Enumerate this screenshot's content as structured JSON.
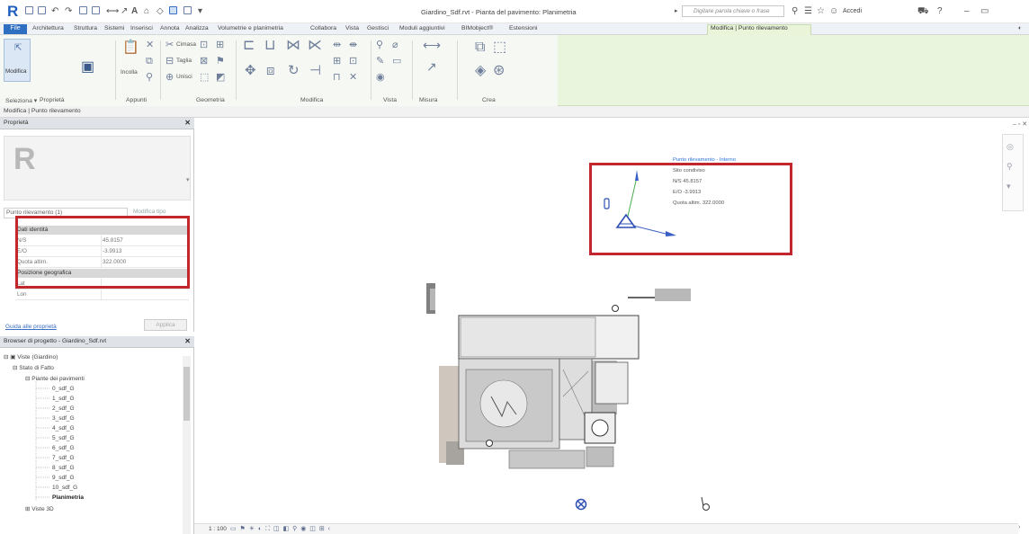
{
  "title_bar": {
    "document_title": "Giardino_Sdf.rvt - Pianta del pavimento: Planimetria",
    "search_placeholder": "Digitare parola chiave o frase",
    "sign_in": "Accedi",
    "app_logo": "R"
  },
  "menu": {
    "file": "File",
    "tabs": [
      "Architettura",
      "Struttura",
      "Sistemi",
      "Inserisci",
      "Annota",
      "Analizza",
      "Volumetrie e planimetria",
      "Collabora",
      "Vista",
      "Gestisci",
      "Moduli aggiuntivi",
      "BIMobject®",
      "Estensioni",
      "Modifica | Punto rilevamento"
    ]
  },
  "ribbon": {
    "modify_label": "Modifica",
    "paste_label": "Incolla",
    "geometry_items": [
      "Cimasa",
      "Taglia",
      "Unisci"
    ],
    "group_labels": [
      "Seleziona ▾",
      "Proprietà",
      "Appunti",
      "Geometria",
      "Modifica",
      "Vista",
      "Misura",
      "Crea"
    ]
  },
  "context_bar": {
    "label": "Modifica | Punto rilevamento"
  },
  "properties": {
    "title": "Proprietà",
    "type_selector": "Punto rilevamento (1)",
    "edit_type": "Modifica tipo",
    "group_identity": "Dati identità",
    "rows": [
      {
        "name": "N/S",
        "value": "45.8157"
      },
      {
        "name": "E/O",
        "value": "-3.9913"
      },
      {
        "name": "Quota altim.",
        "value": "322.0000"
      }
    ],
    "group_geo": "Posizione geografica",
    "geo_rows": [
      {
        "name": "Lat",
        "value": ""
      },
      {
        "name": "Lon",
        "value": ""
      }
    ],
    "help_link": "Guida alle proprietà",
    "apply_button": "Applica"
  },
  "project_browser": {
    "title": "Browser di progetto - Giardino_Sdf.rvt",
    "root": "Viste (Giardino)",
    "phase": "Stato di Fatto",
    "category": "Piante dei pavimenti",
    "views": [
      "0_sdf_G",
      "1_sdf_G",
      "2_sdf_G",
      "3_sdf_G",
      "4_sdf_G",
      "5_sdf_G",
      "6_sdf_G",
      "7_sdf_G",
      "8_sdf_G",
      "9_sdf_G",
      "10_sdf_G"
    ],
    "active_view": "Planimetria",
    "next_category": "Viste 3D"
  },
  "view": {
    "scale": "1 : 100"
  },
  "survey_callout": {
    "title": "Punto rilevamento - Interno",
    "subtitle": "Sito condiviso",
    "ns": "N/S  45.8157",
    "eo": "E/O  -3.9913",
    "elev": "Quota altim.  322.0000"
  },
  "colors": {
    "highlight": "#c1272d",
    "ribbon_bg": "#eaf5dd",
    "accent": "#2f6fc1"
  }
}
